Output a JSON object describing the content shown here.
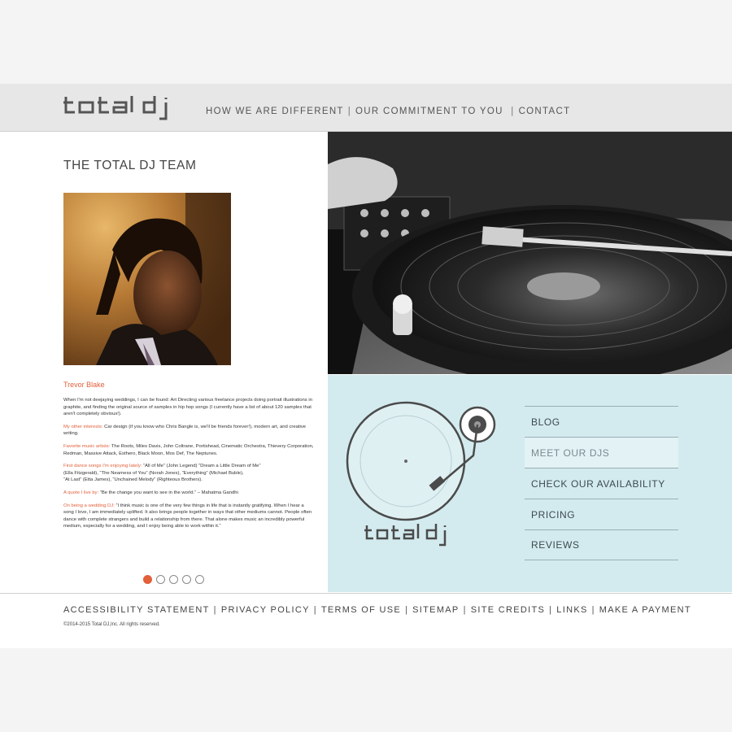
{
  "brand": {
    "logo_text": "total dj"
  },
  "topnav": {
    "items": [
      "HOW WE ARE DIFFERENT",
      "OUR COMMITMENT TO YOU",
      "CONTACT"
    ]
  },
  "team": {
    "title": "THE TOTAL DJ TEAM",
    "member_name": "Trevor Blake",
    "bio_intro": "When I'm not deejaying weddings, I can be found:  Art Directing various freelance projects doing portrait illustrations in graphite, and finding the original source of samples in hip hop songs (I currently have a list of about 120 samples that aren't completely obvious!).",
    "interests_label": "My other interests:",
    "interests_text": "  Car design (if you know who Chris Bangle is, we'll be friends forever!), modern art, and creative writing.",
    "artists_label": "Favorite music artists:",
    "artists_text": "  The Roots, Miles Davis, John Coltrane, Portishead, Cinematic Orchestra, Thievery Corporation, Redman, Massive Attack, Esthero, Black Moon, Mos Def, The Neptunes.",
    "songs_label": "First dance songs I'm enjoying lately:",
    "songs_line1": "  “All of Me” (John Legend) “Dream a Little Dream of Me”",
    "songs_line2": "(Ella Fitzgerald), “The Nearness of You” (Norah Jones), “Everything” (Michael Buble),",
    "songs_line3": "“At Last” (Etta James), “Unchained Melody” (Righteous Brothers).",
    "quote_label": "A quote I live by:",
    "quote_text": "  “Be the change you want to see in the world.” – Mahatma Gandhi",
    "wedding_label": "On being a wedding DJ:",
    "wedding_text": "  “I think music is one of the very few things in life that is instantly gratifying. When I hear a song I love, I am immediately uplifted.  It also brings people together in ways that other mediums cannot.  People often dance with complete strangers and build a relationship from there.  That alone makes music an incredibly powerful medium, especially for a wedding, and I enjoy being able to work within it.”"
  },
  "carousel": {
    "count": 5,
    "active_index": 0
  },
  "sidenav": {
    "items": [
      "BLOG",
      "MEET OUR DJS",
      "CHECK OUR AVAILABILITY",
      "PRICING",
      "REVIEWS"
    ],
    "active_index": 1
  },
  "footer": {
    "links": [
      "ACCESSIBILITY STATEMENT",
      "PRIVACY POLICY",
      "TERMS OF USE",
      "SITEMAP",
      "SITE CREDITS",
      "LINKS",
      "MAKE A PAYMENT"
    ],
    "copyright": "©2014-2015 Total DJ,Inc. All rights reserved."
  },
  "colors": {
    "accent": "#e2603a",
    "panel": "#d3ebef",
    "header": "#e7e7e7",
    "text": "#3a3a3a"
  }
}
